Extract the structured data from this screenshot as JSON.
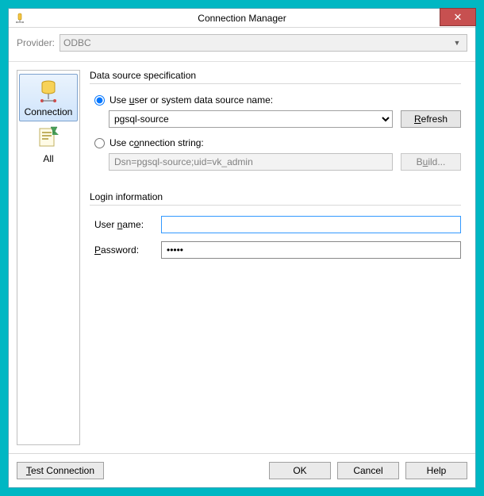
{
  "window": {
    "title": "Connection Manager",
    "close_glyph": "✕"
  },
  "provider": {
    "label": "Provider:",
    "value": "ODBC"
  },
  "nav": {
    "items": [
      {
        "label": "Connection",
        "selected": true
      },
      {
        "label": "All",
        "selected": false
      }
    ]
  },
  "dss": {
    "group_title": "Data source specification",
    "radio_dsn_label": "Use user or system data source name:",
    "radio_conn_label": "Use connection string:",
    "dsn_selected": "pgsql-source",
    "refresh_label": "Refresh",
    "conn_string": "Dsn=pgsql-source;uid=vk_admin",
    "build_label": "Build...",
    "selected_radio": "dsn"
  },
  "login": {
    "group_title": "Login information",
    "user_label": "User name:",
    "user_value": "",
    "pass_label": "Password:",
    "pass_value": "•••••"
  },
  "footer": {
    "test_label": "Test Connection",
    "ok_label": "OK",
    "cancel_label": "Cancel",
    "help_label": "Help"
  }
}
